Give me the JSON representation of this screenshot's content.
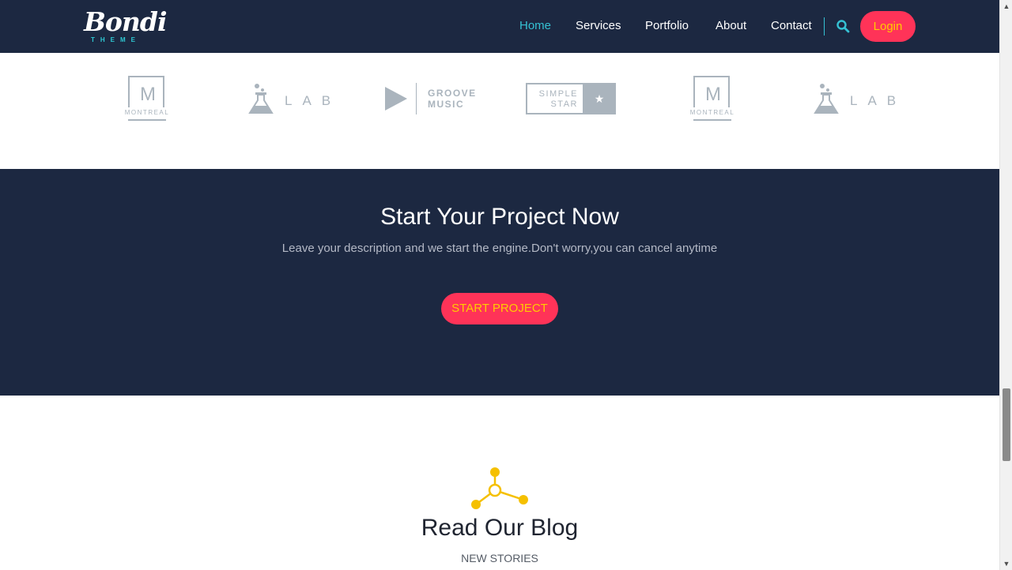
{
  "header": {
    "logo_word": "Bondi",
    "logo_sub": "THEME",
    "nav": [
      {
        "label": "Home",
        "active": true
      },
      {
        "label": "Services"
      },
      {
        "label": "Portfolio"
      },
      {
        "label": "About"
      },
      {
        "label": "Contact"
      }
    ],
    "login_label": "Login"
  },
  "brands": {
    "montreal_letter": "M",
    "montreal_word": "MONTREAL",
    "lab_word": "LAB",
    "groove_line1": "GROOVE",
    "groove_line2": "MUSIC",
    "simple_line1": "SIMPLE",
    "simple_line2": "STAR"
  },
  "cta": {
    "title": "Start Your Project Now",
    "description": "Leave your description and we start the engine.Don't worry,you can cancel anytime",
    "button_label": "START PROJECT"
  },
  "blog": {
    "title": "Read Our Blog",
    "subtitle": "NEW STORIES"
  },
  "colors": {
    "navy": "#1c2841",
    "accent_pink": "#ff3358",
    "accent_yellow": "#ffcc00",
    "teal": "#35c1d3",
    "logo_grey": "#aab4bd"
  },
  "icons": [
    "search-icon",
    "flask-icon",
    "play-icon",
    "star-icon",
    "molecule-icon"
  ]
}
